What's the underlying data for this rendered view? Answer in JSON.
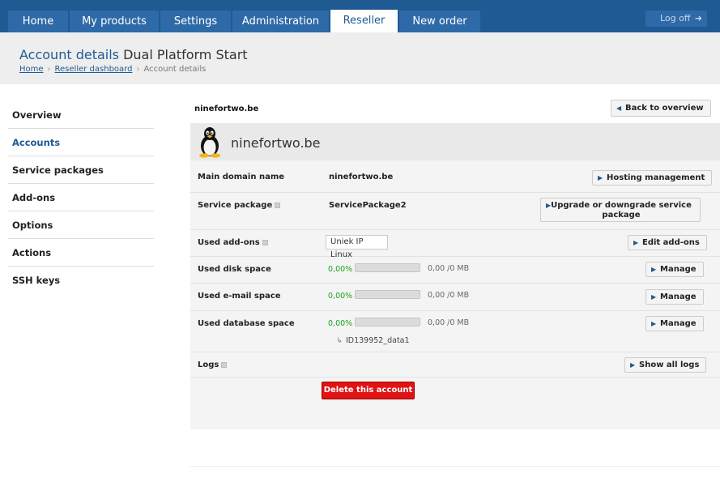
{
  "nav": {
    "tabs": [
      {
        "label": "Home"
      },
      {
        "label": "My products"
      },
      {
        "label": "Settings"
      },
      {
        "label": "Administration"
      },
      {
        "label": "Reseller"
      },
      {
        "label": "New order"
      }
    ],
    "logoff_label": "Log off"
  },
  "header": {
    "title_main": "Account details",
    "title_sub": "Dual Platform Start",
    "breadcrumb": [
      "Home",
      "Reseller dashboard",
      "Account details"
    ]
  },
  "sidebar": {
    "items": [
      {
        "label": "Overview"
      },
      {
        "label": "Accounts"
      },
      {
        "label": "Service packages"
      },
      {
        "label": "Add-ons"
      },
      {
        "label": "Options"
      },
      {
        "label": "Actions"
      },
      {
        "label": "SSH keys"
      }
    ]
  },
  "main": {
    "domain_label": "ninefortwo.be",
    "back_button": "Back to overview",
    "panel_title": "ninefortwo.be",
    "rows": {
      "domain": {
        "label": "Main domain name",
        "value": "ninefortwo.be",
        "button": "Hosting management"
      },
      "package": {
        "label": "Service package",
        "value": "ServicePackage2",
        "button_line1": "Upgrade or downgrade service",
        "button_line2": "package"
      },
      "addons": {
        "label": "Used add-ons",
        "value": "Uniek IP Linux",
        "button": "Edit add-ons"
      },
      "disk": {
        "label": "Used disk space",
        "percent": "0,00%",
        "usage": "0,00 /0 MB",
        "fraction": 0,
        "button": "Manage"
      },
      "email": {
        "label": "Used e-mail space",
        "percent": "0,00%",
        "usage": "0,00 /0 MB",
        "fraction": 0,
        "button": "Manage"
      },
      "database": {
        "label": "Used database space",
        "percent": "0,00%",
        "usage": "0,00 /0 MB",
        "fraction": 0,
        "button": "Manage",
        "db_name": "ID139952_data1"
      },
      "logs": {
        "label": "Logs",
        "button": "Show all logs"
      }
    },
    "delete_button": "Delete this account"
  },
  "colors": {
    "nav_bg": "#1f5a93",
    "tab_bg": "#2e6aa8",
    "accent": "#1f5a93",
    "usage_green": "#22a022",
    "danger": "#e01414"
  }
}
